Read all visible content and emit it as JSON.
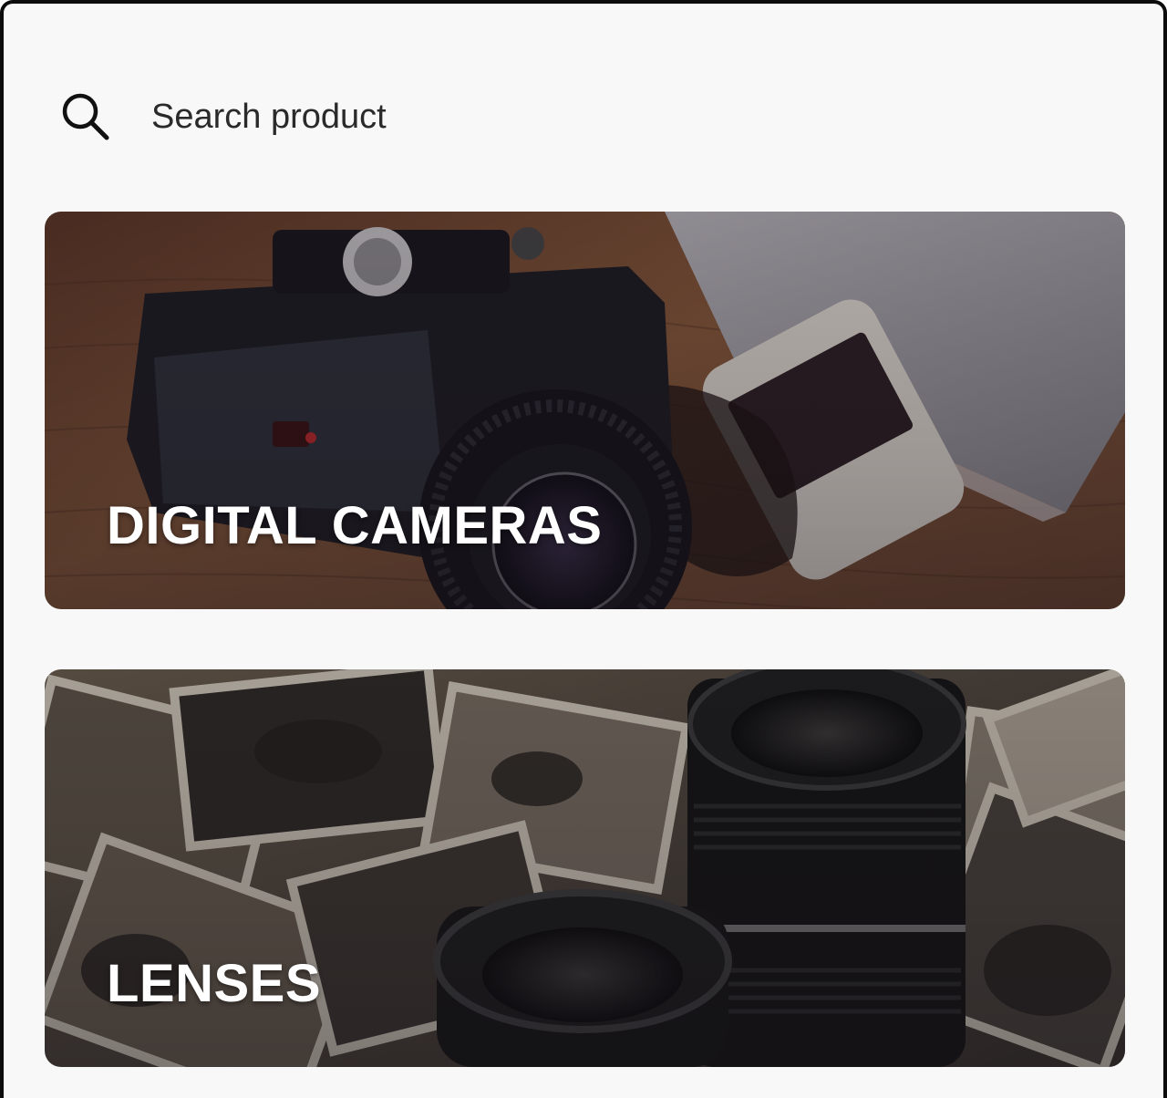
{
  "search": {
    "placeholder": "Search product",
    "icon": "search-icon"
  },
  "categories": [
    {
      "title": "DIGITAL CAMERAS",
      "image": "camera-photo"
    },
    {
      "title": "LENSES",
      "image": "lenses-photo"
    }
  ],
  "colors": {
    "background": "#f8f8f8",
    "frame": "#0c0c0c",
    "title_text": "#ffffff",
    "search_text": "#2a2a2a"
  }
}
